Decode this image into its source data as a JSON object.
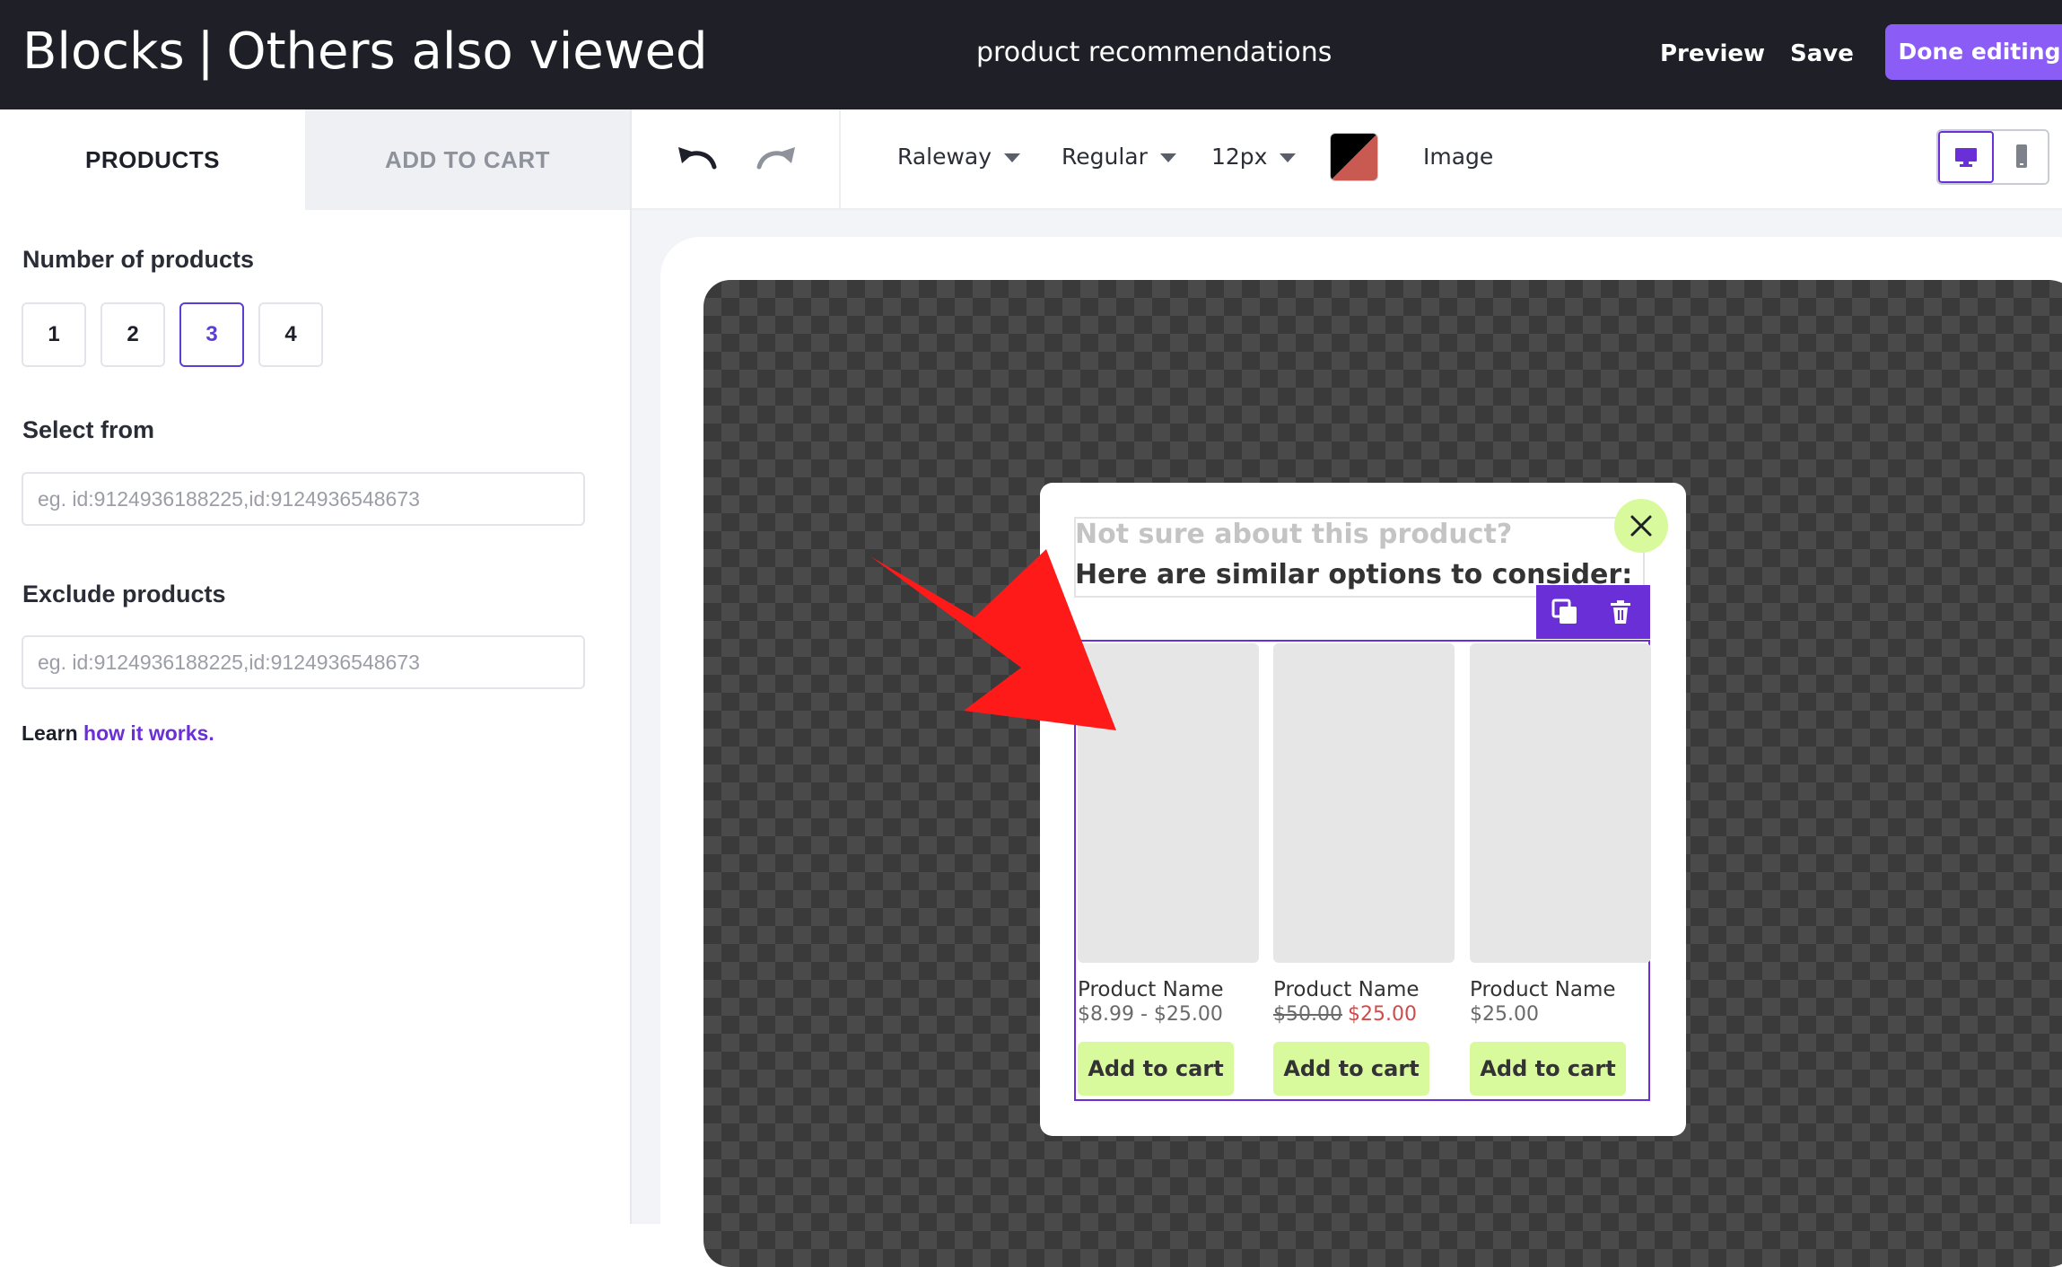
{
  "header": {
    "title_left": "Blocks",
    "title_sep": "|",
    "title_right": "Others also viewed",
    "subtitle": "product recommendations",
    "preview_label": "Preview",
    "save_label": "Save",
    "done_label": "Done editing"
  },
  "left_panel": {
    "tabs": [
      {
        "label": "PRODUCTS",
        "active": true
      },
      {
        "label": "ADD TO CART",
        "active": false
      }
    ],
    "count_label": "Number of products",
    "count_options": [
      "1",
      "2",
      "3",
      "4"
    ],
    "count_selected": "3",
    "select_label": "Select from",
    "select_placeholder": "eg. id:9124936188225,id:9124936548673",
    "exclude_label": "Exclude products",
    "exclude_placeholder": "eg. id:9124936188225,id:9124936548673",
    "learn_prefix": "Learn",
    "learn_link": "how it works."
  },
  "toolbar": {
    "font": "Raleway",
    "weight": "Regular",
    "size": "12px",
    "image_label": "Image",
    "swatch_colors": [
      "#000000",
      "#c85a52"
    ],
    "icons": [
      "undo-icon",
      "redo-icon",
      "desktop-icon",
      "mobile-icon"
    ]
  },
  "popup": {
    "heading_line1": "Not sure about this product?",
    "heading_line2": "Here are similar options to consider:",
    "close_icon": "close-icon",
    "action_icons": [
      "duplicate-icon",
      "trash-icon"
    ],
    "products": [
      {
        "name": "Product Name",
        "price": "$8.99 - $25.00",
        "old_price": "",
        "sale_price": "",
        "cta": "Add to cart"
      },
      {
        "name": "Product Name",
        "price": "",
        "old_price": "$50.00",
        "sale_price": "$25.00",
        "cta": "Add to cart"
      },
      {
        "name": "Product Name",
        "price": "$25.00",
        "old_price": "",
        "sale_price": "",
        "cta": "Add to cart"
      }
    ]
  },
  "colors": {
    "accent": "#6b2fd8",
    "done_button": "#8b5cf6",
    "cta_bg": "#d9f99d",
    "sale_price": "#d04b4b",
    "arrow": "#ff1a1a"
  }
}
